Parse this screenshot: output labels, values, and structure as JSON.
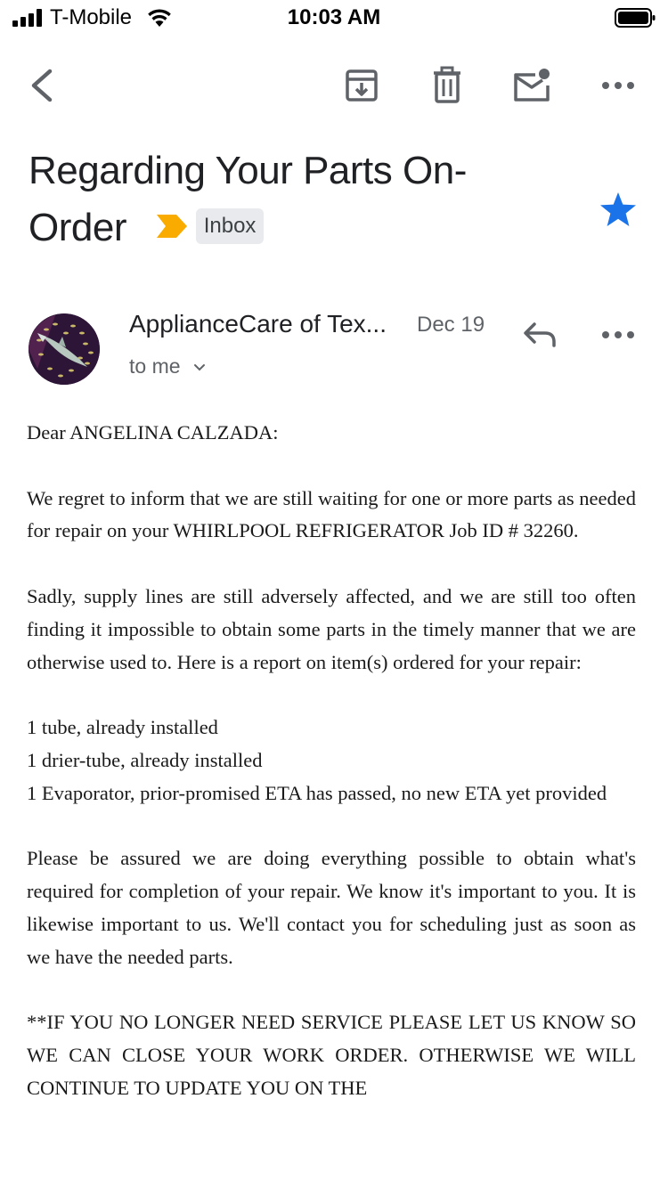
{
  "status_bar": {
    "carrier": "T-Mobile",
    "time": "10:03 AM"
  },
  "toolbar": {
    "icons": [
      "back-arrow-icon",
      "archive-icon",
      "trash-icon",
      "mark-unread-icon",
      "more-vertical-icon"
    ]
  },
  "email": {
    "subject": "Regarding Your Parts On-Order",
    "label": "Inbox",
    "starred": true,
    "colors": {
      "star": "#1a73e8",
      "important": "#f9ab00",
      "chip_bg": "#e8eaed"
    },
    "sender": {
      "name": "ApplianceCare of Tex...",
      "date": "Dec 19",
      "recipient": "to me"
    },
    "body": {
      "greeting": "Dear ANGELINA CALZADA:",
      "paragraph1": "We regret to inform that we are still waiting for one or more parts as needed for repair on your WHIRLPOOL REFRIGERATOR Job ID # 32260.",
      "paragraph2": "Sadly, supply lines are still adversely affected, and we are still too often finding it impossible to obtain some parts in the timely manner that we are otherwise used to. Here is a report on item(s) ordered for your repair:",
      "parts": [
        "1 tube, already installed",
        "1 drier-tube, already installed",
        "1 Evaporator, prior-promised ETA has passed, no new ETA yet provided"
      ],
      "paragraph3": "Please be assured we are doing everything possible to obtain what's required for completion of your repair. We know it's important to you. It is likewise important to us. We'll contact you for scheduling just as soon as we have the needed parts.",
      "paragraph4": "**IF YOU NO LONGER NEED SERVICE PLEASE LET US KNOW SO WE CAN CLOSE YOUR WORK ORDER. OTHERWISE WE WILL CONTINUE TO UPDATE YOU ON THE"
    }
  }
}
